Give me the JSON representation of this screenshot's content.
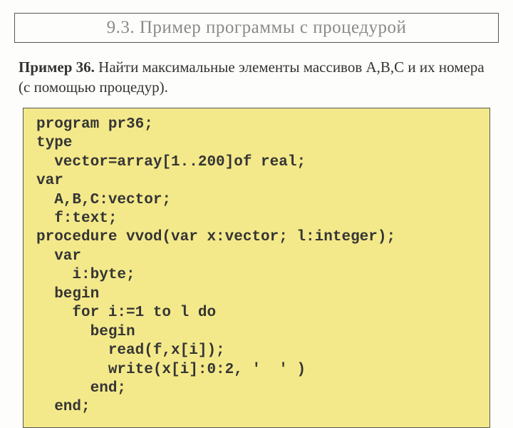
{
  "title": "9.3. Пример  программы с процедурой",
  "problem": {
    "label": "Пример 36.",
    "text": "  Найти максимальные элементы массивов A,B,C и их номера (с помощью процедур)."
  },
  "code": {
    "lines": [
      "program pr36;",
      "type",
      "  vector=array[1..200]of real;",
      "var",
      "  A,B,C:vector;",
      "  f:text;",
      "procedure vvod(var x:vector; l:integer);",
      "  var",
      "    i:byte;",
      "  begin",
      "    for i:=1 to l do",
      "      begin",
      "        read(f,x[i]);",
      "        write(x[i]:0:2, '  ' )",
      "      end;",
      "  end;"
    ]
  }
}
